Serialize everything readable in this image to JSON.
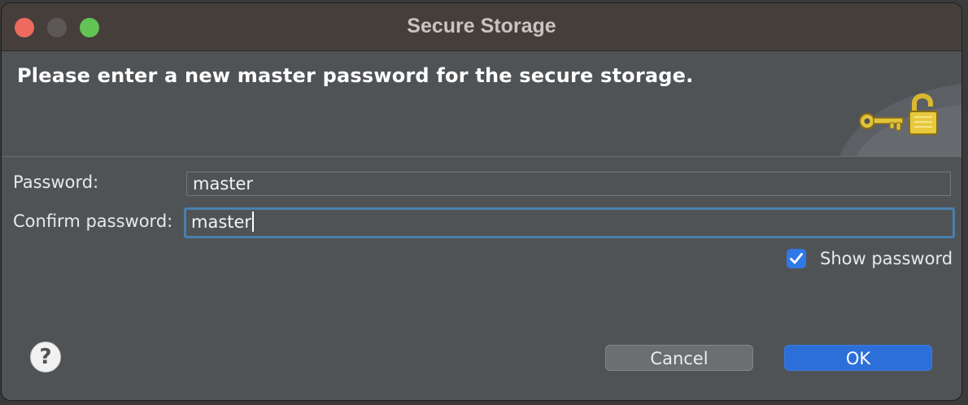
{
  "window": {
    "title": "Secure Storage"
  },
  "banner": {
    "message": "Please enter a new master password for the secure storage.",
    "icons": [
      "key-icon",
      "padlock-icon"
    ]
  },
  "form": {
    "password_label": "Password:",
    "password_value": "master",
    "confirm_label": "Confirm password:",
    "confirm_value": "master",
    "show_password_label": "Show password",
    "show_password_checked": true
  },
  "footer": {
    "help_glyph": "?",
    "cancel_label": "Cancel",
    "ok_label": "OK"
  },
  "colors": {
    "accent": "#2f79e6",
    "ok_button": "#2d6fd9",
    "focus_ring": "#4a7fae",
    "dialog_bg": "#505356",
    "titlebar_bg": "#463e3b"
  }
}
